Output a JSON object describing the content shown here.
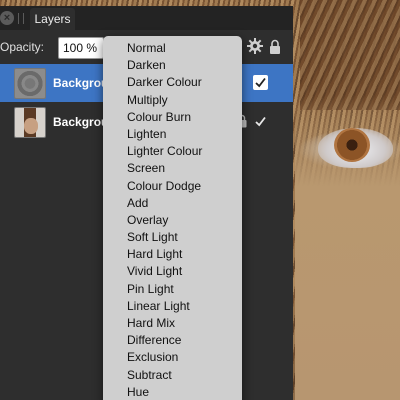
{
  "panel": {
    "tab_label": "Layers",
    "close_symbol": "×",
    "opacity_label": "Opacity:",
    "opacity_value": "100 %"
  },
  "layers": [
    {
      "name": "Backgrou",
      "selected": true,
      "visible": true,
      "thumb": "texture-thumbnail"
    },
    {
      "name": "Backgrou",
      "selected": false,
      "visible": true,
      "thumb": "portrait-thumbnail"
    }
  ],
  "blend_modes": [
    "Normal",
    "Darken",
    "Darker Colour",
    "Multiply",
    "Colour Burn",
    "Lighten",
    "Lighter Colour",
    "Screen",
    "Colour Dodge",
    "Add",
    "Overlay",
    "Soft Light",
    "Hard Light",
    "Vivid Light",
    "Pin Light",
    "Linear Light",
    "Hard Mix",
    "Difference",
    "Exclusion",
    "Subtract",
    "Hue"
  ],
  "icons": [
    "close-icon",
    "grip-icon",
    "gear-icon",
    "lock-icon",
    "checkbox-icon",
    "checkmark-icon"
  ],
  "colors": {
    "panel_bg": "#2e2e2e",
    "selected_row": "#3d75c4",
    "menu_bg": "#cfcfcf"
  }
}
